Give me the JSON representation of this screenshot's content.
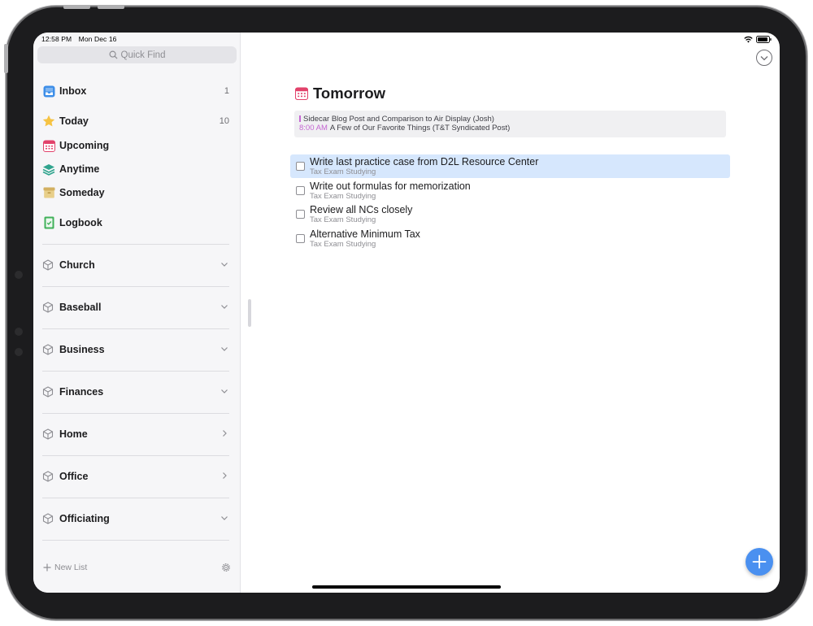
{
  "status_bar": {
    "time": "12:58 PM",
    "date": "Mon Dec 16",
    "wifi_icon": "wifi-icon",
    "battery_icon": "battery-icon"
  },
  "sidebar": {
    "search_placeholder": "Quick Find",
    "nav": [
      {
        "label": "Inbox",
        "count": "1",
        "icon": "inbox-icon",
        "color": "#3d8ee8"
      },
      {
        "label": "Today",
        "count": "10",
        "icon": "star-icon",
        "color": "#f6c343"
      },
      {
        "label": "Upcoming",
        "count": "",
        "icon": "calendar-icon",
        "color": "#e2426b"
      },
      {
        "label": "Anytime",
        "count": "",
        "icon": "stack-icon",
        "color": "#30a48e"
      },
      {
        "label": "Someday",
        "count": "",
        "icon": "archive-box-icon",
        "color": "#e0c072"
      },
      {
        "label": "Logbook",
        "count": "",
        "icon": "logbook-icon",
        "color": "#41b15a"
      }
    ],
    "areas": [
      {
        "label": "Church",
        "chevron": "down"
      },
      {
        "label": "Baseball",
        "chevron": "down"
      },
      {
        "label": "Business",
        "chevron": "down"
      },
      {
        "label": "Finances",
        "chevron": "down"
      },
      {
        "label": "Home",
        "chevron": "right"
      },
      {
        "label": "Office",
        "chevron": "right"
      },
      {
        "label": "Officiating",
        "chevron": "down"
      }
    ],
    "new_list_label": "New List"
  },
  "main": {
    "title": "Tomorrow",
    "events": [
      {
        "time": "",
        "title": "Sidecar Blog Post and Comparison to Air Display (Josh)"
      },
      {
        "time": "8:00 AM",
        "title": "A Few of Our Favorite Things (T&T Syndicated Post)"
      }
    ],
    "todos": [
      {
        "title": "Write last practice case from D2L Resource Center",
        "project": "Tax Exam Studying",
        "selected": true
      },
      {
        "title": "Write out formulas for memorization",
        "project": "Tax Exam Studying",
        "selected": false
      },
      {
        "title": "Review all NCs closely",
        "project": "Tax Exam Studying",
        "selected": false
      },
      {
        "title": "Alternative Minimum Tax",
        "project": "Tax Exam Studying",
        "selected": false
      }
    ]
  },
  "colors": {
    "accent": "#4a90f0",
    "selection": "#d6e7fd",
    "event_accent": "#c567d2"
  }
}
